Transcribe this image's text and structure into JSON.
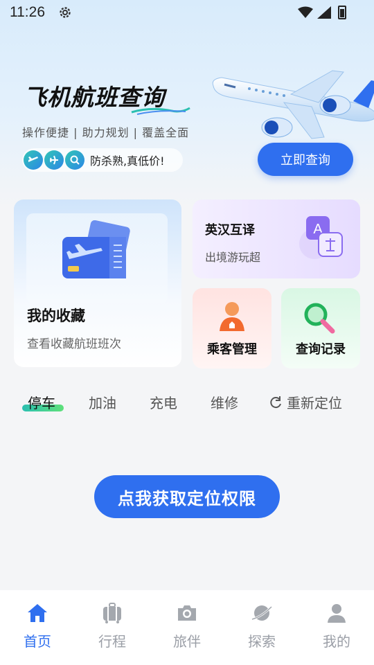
{
  "status_bar": {
    "time": "11:26"
  },
  "hero": {
    "title": "飞机航班查询",
    "subtitle": "操作便捷 | 助力规划 | 覆盖全面",
    "promo": "防杀熟,真低价!",
    "query_button": "立即查询"
  },
  "cards": {
    "favorites": {
      "title": "我的收藏",
      "subtitle": "查看收藏航班班次"
    },
    "translate": {
      "title": "英汉互译",
      "subtitle": "出境游玩超"
    },
    "passengers": {
      "title": "乘客管理"
    },
    "history": {
      "title": "查询记录"
    }
  },
  "service_tabs": {
    "items": [
      "停车",
      "加油",
      "充电",
      "维修"
    ],
    "active": "停车",
    "relocate": "重新定位"
  },
  "location_button": "点我获取定位权限",
  "bottom_nav": {
    "items": [
      {
        "label": "首页",
        "icon": "home-icon",
        "active": true
      },
      {
        "label": "行程",
        "icon": "luggage-icon",
        "active": false
      },
      {
        "label": "旅伴",
        "icon": "camera-icon",
        "active": false
      },
      {
        "label": "探索",
        "icon": "planet-icon",
        "active": false
      },
      {
        "label": "我的",
        "icon": "user-icon",
        "active": false
      }
    ]
  },
  "colors": {
    "accent": "#2f6fef",
    "tab_underline": "#2bbfb0",
    "inactive": "#9a9ea6"
  }
}
